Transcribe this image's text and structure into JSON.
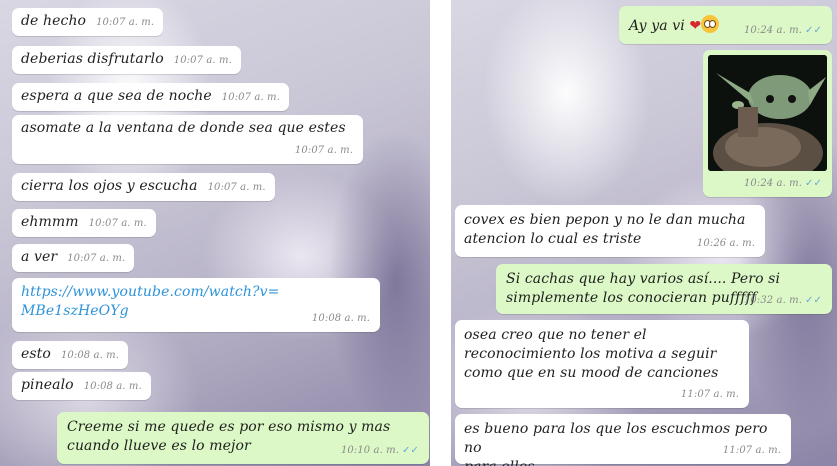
{
  "left_chat": {
    "messages": [
      {
        "text": "de hecho",
        "time": "10:07 a. m."
      },
      {
        "text": "deberias disfrutarlo",
        "time": "10:07 a. m."
      },
      {
        "text": "espera a que sea de noche",
        "time": "10:07 a. m."
      },
      {
        "text": "asomate a la ventana de donde sea que estes",
        "time": "10:07 a. m."
      },
      {
        "text": "cierra los ojos y escucha",
        "time": "10:07 a. m."
      },
      {
        "text": "ehmmm",
        "time": "10:07 a. m."
      },
      {
        "text": "a ver",
        "time": "10:07 a. m."
      },
      {
        "text_line1": "https://www.youtube.com/watch?v=",
        "text_line2": "MBe1szHeOYg",
        "time": "10:08 a. m."
      },
      {
        "text": "esto",
        "time": "10:08 a. m."
      },
      {
        "text": "pinealo",
        "time": "10:08 a. m."
      },
      {
        "text_line1": "Creeme si me quede es por eso mismo y mas",
        "text_line2": "cuando llueve es lo mejor",
        "time": "10:10 a. m.",
        "status": "✓✓"
      }
    ]
  },
  "right_chat": {
    "messages": [
      {
        "text": "Ay ya vi",
        "emoji": "❤",
        "time": "10:24 a. m.",
        "status": "✓✓"
      },
      {
        "image": "baby-yoda-photo",
        "time": "10:24 a. m.",
        "status": "✓✓"
      },
      {
        "text_line1": "covex es bien pepon y no le dan mucha",
        "text_line2": "atencion lo cual es triste",
        "time": "10:26 a. m."
      },
      {
        "text_line1": "Si cachas que hay varios así.... Pero si",
        "text_line2": "simplemente los conocieran pufffff",
        "time": "10:32 a. m.",
        "status": "✓✓"
      },
      {
        "text_line1": "osea creo que no tener el",
        "text_line2": "reconocimiento los motiva  a seguir",
        "text_line3": "como que en su mood de canciones",
        "time": "11:07 a. m."
      },
      {
        "text_line1": "es bueno para los que los escuchmos pero no",
        "text_line2": "para ellos",
        "time": "11:07 a. m."
      }
    ]
  },
  "colors": {
    "incoming_bubble": "#ffffff",
    "outgoing_bubble": "#dcf8c6",
    "link": "#2e93d8",
    "read_ticks": "#6aa5d6"
  }
}
